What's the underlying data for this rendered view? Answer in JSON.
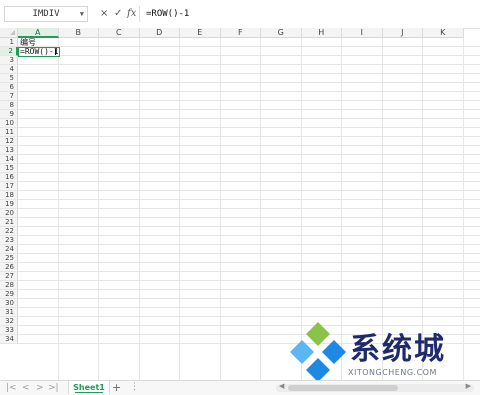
{
  "formula_bar": {
    "name_box": "IMDIV",
    "cancel_glyph": "×",
    "confirm_glyph": "✓",
    "fx_label": "fx",
    "formula": "=ROW()-1"
  },
  "columns": [
    "A",
    "B",
    "C",
    "D",
    "E",
    "F",
    "G",
    "H",
    "I",
    "J",
    "K"
  ],
  "active_column": "A",
  "rows": [
    "1",
    "2",
    "3",
    "4",
    "5",
    "6",
    "7",
    "8",
    "9",
    "10",
    "11",
    "12",
    "13",
    "14",
    "15",
    "16",
    "17",
    "18",
    "19",
    "20",
    "21",
    "22",
    "23",
    "24",
    "25",
    "26",
    "27",
    "28",
    "29",
    "30",
    "31",
    "32",
    "33",
    "34"
  ],
  "active_row": "2",
  "cells": {
    "A1": "编号",
    "A2": "=ROW()-1"
  },
  "sheet_tabs": [
    "Sheet1"
  ],
  "tabbar": {
    "nav_first": "|<",
    "nav_prev": "<",
    "nav_next": ">",
    "nav_last": ">|",
    "add_glyph": "+",
    "more_glyph": "⋮"
  },
  "watermark": {
    "brand": "系统城",
    "url": "XITONGCHENG.COM",
    "colors": {
      "blue": "#1e88e5",
      "light_blue": "#5bb6f2",
      "green": "#8bc34a",
      "text": "#1d2a6b"
    }
  },
  "colors": {
    "accent": "#1f9d55",
    "header_bg": "#f4f4f4",
    "gridline": "#e6e6e6"
  }
}
